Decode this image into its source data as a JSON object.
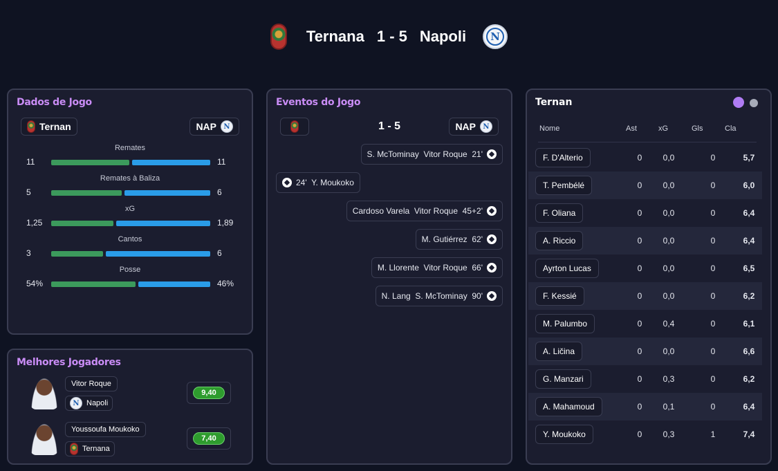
{
  "header": {
    "home": "Ternana",
    "score": "1 - 5",
    "away": "Napoli"
  },
  "dados": {
    "title": "Dados de Jogo",
    "home": "Ternan",
    "away": "NAP",
    "stats": [
      {
        "label": "Remates",
        "home": "11",
        "away": "11",
        "home_share": 0.5
      },
      {
        "label": "Remates à Baliza",
        "home": "5",
        "away": "6",
        "home_share": 0.45
      },
      {
        "label": "xG",
        "home": "1,25",
        "away": "1,89",
        "home_share": 0.4
      },
      {
        "label": "Cantos",
        "home": "3",
        "away": "6",
        "home_share": 0.33
      },
      {
        "label": "Posse",
        "home": "54%",
        "away": "46%",
        "home_share": 0.54
      }
    ]
  },
  "melhores": {
    "title": "Melhores Jogadores",
    "players": [
      {
        "name": "Vitor Roque",
        "team": "Napoli",
        "rating": "9,40"
      },
      {
        "name": "Youssoufa Moukoko",
        "team": "Ternana",
        "rating": "7,40"
      }
    ]
  },
  "eventos": {
    "title": "Eventos do Jogo",
    "score": "1 - 5",
    "away": "NAP",
    "events": [
      {
        "text": "S. McTominay  Vitor Roque  21'",
        "side": "right"
      },
      {
        "text": "24'  Y. Moukoko",
        "side": "left"
      },
      {
        "text": "Cardoso Varela  Vitor Roque  45+2'",
        "side": "right"
      },
      {
        "text": "M. Gutiérrez  62'",
        "side": "right"
      },
      {
        "text": "M. Llorente  Vitor Roque  66'",
        "side": "right"
      },
      {
        "text": "N. Lang  S. McTominay  90'",
        "side": "right"
      }
    ]
  },
  "ternan": {
    "title": "Ternan",
    "columns": [
      "Nome",
      "Ast",
      "xG",
      "Gls",
      "Cla"
    ],
    "rows": [
      {
        "name": "F. D'Alterio",
        "ast": "0",
        "xg": "0,0",
        "gls": "0",
        "cla": "5,7"
      },
      {
        "name": "T. Pembélé",
        "ast": "0",
        "xg": "0,0",
        "gls": "0",
        "cla": "6,0"
      },
      {
        "name": "F. Oliana",
        "ast": "0",
        "xg": "0,0",
        "gls": "0",
        "cla": "6,4"
      },
      {
        "name": "A. Riccio",
        "ast": "0",
        "xg": "0,0",
        "gls": "0",
        "cla": "6,4"
      },
      {
        "name": "Ayrton Lucas",
        "ast": "0",
        "xg": "0,0",
        "gls": "0",
        "cla": "6,5"
      },
      {
        "name": "F. Kessié",
        "ast": "0",
        "xg": "0,0",
        "gls": "0",
        "cla": "6,2"
      },
      {
        "name": "M. Palumbo",
        "ast": "0",
        "xg": "0,4",
        "gls": "0",
        "cla": "6,1"
      },
      {
        "name": "A. Ličina",
        "ast": "0",
        "xg": "0,0",
        "gls": "0",
        "cla": "6,6"
      },
      {
        "name": "G. Manzari",
        "ast": "0",
        "xg": "0,3",
        "gls": "0",
        "cla": "6,2"
      },
      {
        "name": "A. Mahamoud",
        "ast": "0",
        "xg": "0,1",
        "gls": "0",
        "cla": "6,4"
      },
      {
        "name": "Y. Moukoko",
        "ast": "0",
        "xg": "0,3",
        "gls": "1",
        "cla": "7,4"
      }
    ]
  },
  "colors": {
    "accent": "#c98cf5",
    "home_bar": "#3c9a5c",
    "away_bar": "#2a9ce8",
    "rating": "#2e9c2e"
  }
}
